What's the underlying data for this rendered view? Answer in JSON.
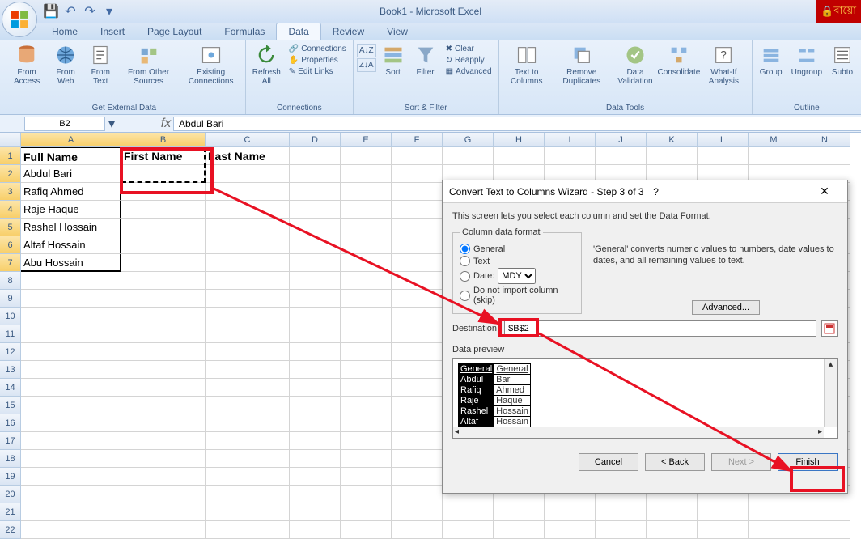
{
  "window": {
    "title": "Book1 - Microsoft Excel",
    "rightBadge": "বায়ো"
  },
  "tabs": [
    "Home",
    "Insert",
    "Page Layout",
    "Formulas",
    "Data",
    "Review",
    "View"
  ],
  "activeTab": "Data",
  "ribbon": {
    "groups": {
      "getExternal": {
        "label": "Get External Data",
        "fromAccess": "From\nAccess",
        "fromWeb": "From\nWeb",
        "fromText": "From\nText",
        "fromOther": "From Other\nSources",
        "existing": "Existing\nConnections"
      },
      "connections": {
        "label": "Connections",
        "refresh": "Refresh\nAll",
        "conn": "Connections",
        "props": "Properties",
        "editLinks": "Edit Links"
      },
      "sortFilter": {
        "label": "Sort & Filter",
        "sortAZ": "A→Z",
        "sortZA": "Z→A",
        "sort": "Sort",
        "filter": "Filter",
        "clear": "Clear",
        "reapply": "Reapply",
        "advanced": "Advanced"
      },
      "dataTools": {
        "label": "Data Tools",
        "textToCols": "Text to\nColumns",
        "removeDup": "Remove\nDuplicates",
        "validation": "Data\nValidation",
        "consolidate": "Consolidate",
        "whatIf": "What-If\nAnalysis"
      },
      "outline": {
        "label": "Outline",
        "group": "Group",
        "ungroup": "Ungroup",
        "subtotal": "Subto"
      }
    }
  },
  "namebox": "B2",
  "formula": "Abdul Bari",
  "columns": [
    "A",
    "B",
    "C",
    "D",
    "E",
    "F",
    "G",
    "H",
    "I",
    "J",
    "K",
    "L",
    "M",
    "N"
  ],
  "headers": {
    "A": "Full Name",
    "B": "First Name",
    "C": "Last Name"
  },
  "dataRows": [
    {
      "A": "Abdul Bari"
    },
    {
      "A": "Rafiq Ahmed"
    },
    {
      "A": "Raje Haque"
    },
    {
      "A": "Rashel Hossain"
    },
    {
      "A": "Altaf Hossain"
    },
    {
      "A": "Abu Hossain"
    }
  ],
  "dialog": {
    "title": "Convert Text to Columns Wizard - Step 3 of 3",
    "desc": "This screen lets you select each column and set the Data Format.",
    "formatLegend": "Column data format",
    "radioGeneral": "General",
    "radioText": "Text",
    "radioDate": "Date:",
    "dateFormat": "MDY",
    "radioSkip": "Do not import column (skip)",
    "generalNote": "'General' converts numeric values to numbers, date values to dates, and all remaining values to text.",
    "advanced": "Advanced...",
    "destLabel": "Destination:",
    "destValue": "$B$2",
    "previewLabel": "Data preview",
    "previewHeaders": [
      "General",
      "General"
    ],
    "previewRows": [
      [
        "Abdul",
        "Bari"
      ],
      [
        "Rafiq",
        "Ahmed"
      ],
      [
        "Raje",
        "Haque"
      ],
      [
        "Rashel",
        "Hossain"
      ],
      [
        "Altaf",
        "Hossain"
      ]
    ],
    "btnCancel": "Cancel",
    "btnBack": "< Back",
    "btnNext": "Next >",
    "btnFinish": "Finish"
  }
}
